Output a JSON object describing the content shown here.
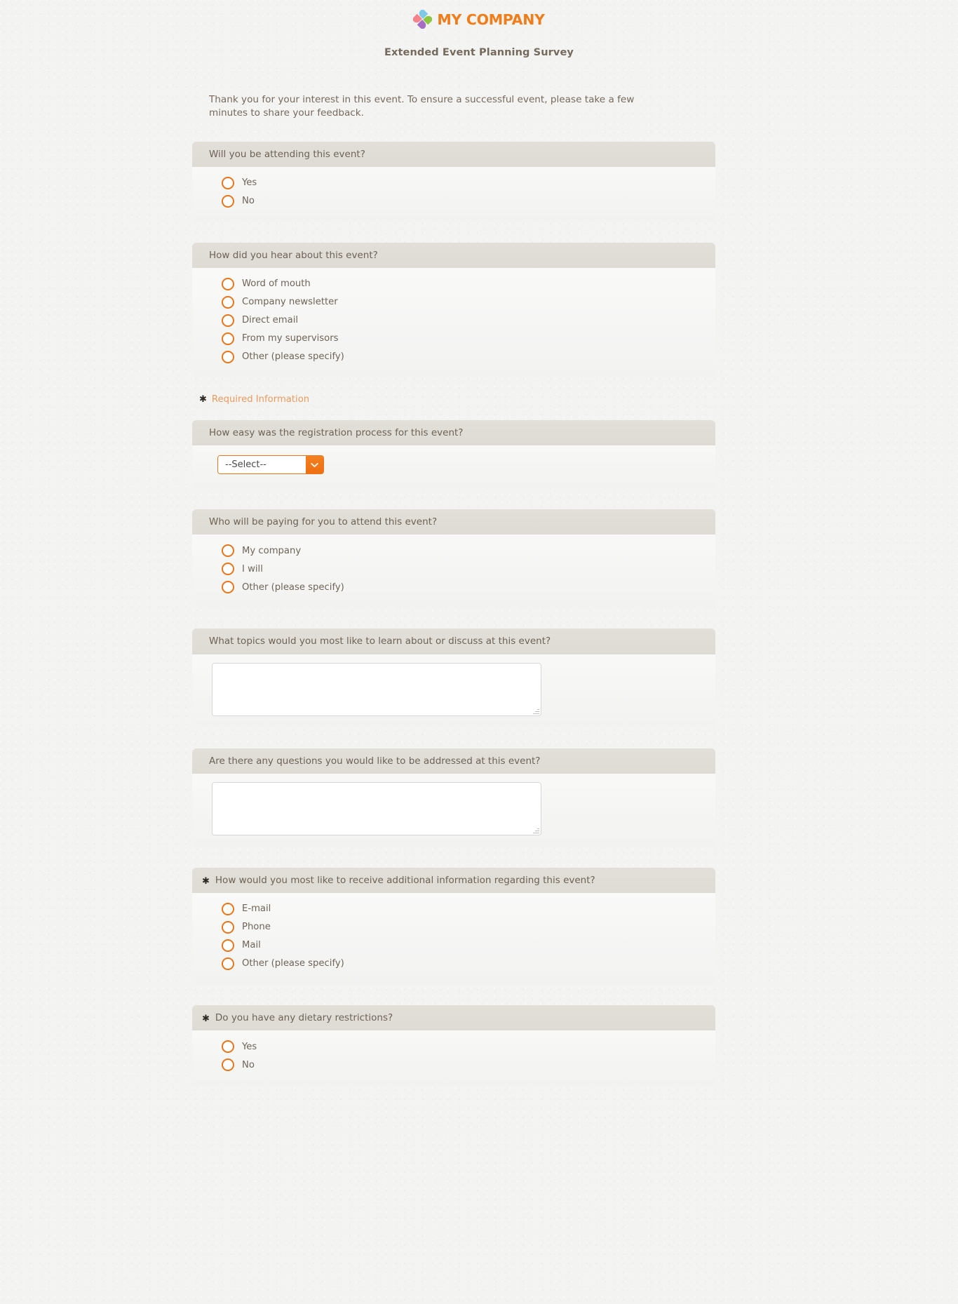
{
  "header": {
    "logo_icon": "pinwheel-diamond-logo",
    "company_name": "MY COMPANY",
    "logo_color": "#f07d1a",
    "form_title": "Extended Event Planning Survey"
  },
  "intro": {
    "text": "Thank you for your interest in this event. To ensure a successful event, please take a few minutes to share your feedback."
  },
  "required_note": {
    "star": "✱",
    "label": "Required Information",
    "color": "#eb9a5e"
  },
  "theme": {
    "accent": "#e8751a",
    "header_band": "#dedbd4",
    "question_text": "#6d6255",
    "body_text": "#6f6456",
    "page_background": "#f3f3f2"
  },
  "questions": [
    {
      "id": "attending",
      "required": false,
      "star": "",
      "label": "Will you be attending this event?",
      "type": "radio",
      "options": [
        "Yes",
        "No"
      ]
    },
    {
      "id": "hear-about",
      "required": false,
      "star": "",
      "label": "How did you hear about this event?",
      "type": "radio",
      "options": [
        "Word of mouth",
        "Company newsletter",
        "Direct email",
        "From my supervisors",
        "Other (please specify)"
      ]
    },
    {
      "id": "registration-ease",
      "required": false,
      "star": "",
      "label": "How easy was the registration process for this event?",
      "type": "select",
      "selected": "--Select--",
      "arrow_icon": "chevron-down-icon"
    },
    {
      "id": "who-pays",
      "required": false,
      "star": "",
      "label": "Who will be paying for you to attend this event?",
      "type": "radio",
      "options": [
        "My company",
        "I will",
        "Other (please specify)"
      ]
    },
    {
      "id": "topics",
      "required": false,
      "star": "",
      "label": "What topics would you most like to learn about or discuss at this event?",
      "type": "textarea",
      "value": "",
      "placeholder": ""
    },
    {
      "id": "questions-addressed",
      "required": false,
      "star": "",
      "label": "Are there any questions you would like to be addressed at this event?",
      "type": "textarea",
      "value": "",
      "placeholder": ""
    },
    {
      "id": "contact-method",
      "required": true,
      "star": "✱",
      "label": "How would you most like to receive additional information regarding this event?",
      "type": "radio",
      "options": [
        "E-mail",
        "Phone",
        "Mail",
        "Other (please specify)"
      ]
    },
    {
      "id": "dietary",
      "required": true,
      "star": "✱",
      "label": "Do you have any dietary restrictions?",
      "type": "radio",
      "options": [
        "Yes",
        "No"
      ]
    }
  ]
}
